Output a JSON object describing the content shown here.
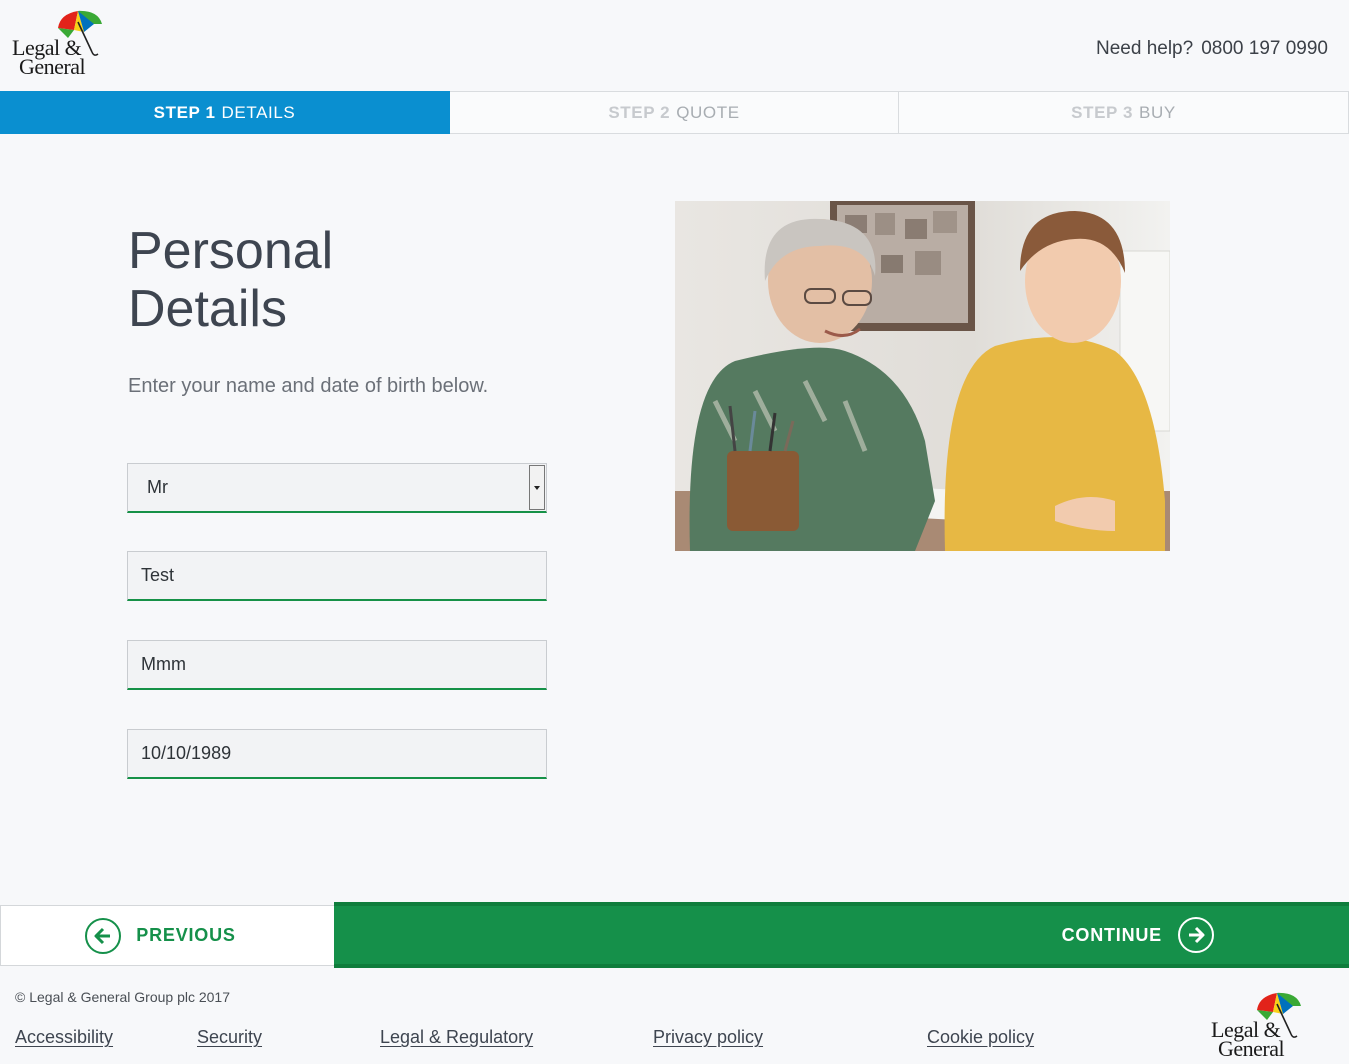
{
  "header": {
    "logo": {
      "line1": "Legal &",
      "line2": "General"
    },
    "help_label": "Need help?",
    "help_phone": "0800 197 0990"
  },
  "steps": [
    {
      "prefix": "STEP 1",
      "name": "DETAILS",
      "active": true
    },
    {
      "prefix": "STEP 2",
      "name": "QUOTE",
      "active": false
    },
    {
      "prefix": "STEP 3",
      "name": "BUY",
      "active": false
    }
  ],
  "main": {
    "title_line1": "Personal",
    "title_line2": "Details",
    "intro": "Enter your name and date of birth below.",
    "fields": {
      "title_select": "Mr",
      "first_name": "Test",
      "last_name": "Mmm",
      "dob": "10/10/1989"
    }
  },
  "nav": {
    "previous_label": "PREVIOUS",
    "continue_label": "CONTINUE"
  },
  "footer": {
    "copyright": "© Legal & General Group plc 2017",
    "links": [
      "Accessibility",
      "Security",
      "Legal & Regulatory",
      "Privacy policy",
      "Cookie policy"
    ]
  },
  "colors": {
    "accent_blue": "#0a8fd0",
    "accent_green": "#15904a",
    "background": "#f7f8fa"
  }
}
